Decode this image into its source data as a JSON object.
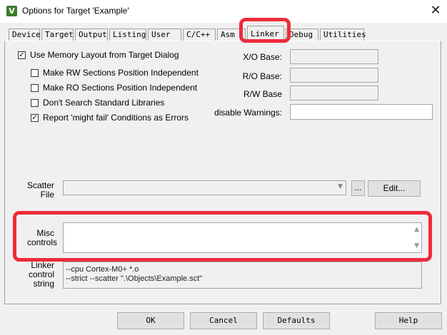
{
  "window": {
    "title": "Options for Target 'Example'",
    "app_icon_letter": "V",
    "close_glyph": "✕"
  },
  "tabs": [
    {
      "label": "Device"
    },
    {
      "label": "Target"
    },
    {
      "label": "Output"
    },
    {
      "label": "Listing"
    },
    {
      "label": "User"
    },
    {
      "label": "C/C++"
    },
    {
      "label": "Asm"
    },
    {
      "label": "Linker",
      "active": true
    },
    {
      "label": "Debug"
    },
    {
      "label": "Utilities"
    }
  ],
  "options": {
    "use_memory_layout": {
      "label": "Use Memory Layout from Target Dialog",
      "checked": true
    },
    "rw_independent": {
      "label": "Make RW Sections Position Independent",
      "checked": false
    },
    "ro_independent": {
      "label": "Make RO Sections Position Independent",
      "checked": false
    },
    "dont_search_std": {
      "label": "Don't Search Standard Libraries",
      "checked": false
    },
    "might_fail_errors": {
      "label": "Report 'might fail' Conditions as Errors",
      "checked": true
    }
  },
  "bases": {
    "xo_label": "X/O Base:",
    "xo_value": "",
    "ro_label": "R/O Base:",
    "ro_value": "",
    "rw_label": "R/W Base",
    "rw_value": "",
    "warnings_label": "disable Warnings:",
    "warnings_value": ""
  },
  "scatter": {
    "label_line1": "Scatter",
    "label_line2": "File",
    "value": "",
    "browse_label": "...",
    "edit_label": "Edit..."
  },
  "misc": {
    "label_line1": "Misc",
    "label_line2": "controls",
    "value": ""
  },
  "linker_string": {
    "label_line1": "Linker",
    "label_line2": "control",
    "label_line3": "string",
    "line1": "--cpu Cortex-M0+ *.o",
    "line2": "--strict --scatter \".\\Objects\\Example.sct\""
  },
  "buttons": {
    "ok": "OK",
    "cancel": "Cancel",
    "defaults": "Defaults",
    "help": "Help"
  },
  "highlight_color": "#ee2b3a"
}
